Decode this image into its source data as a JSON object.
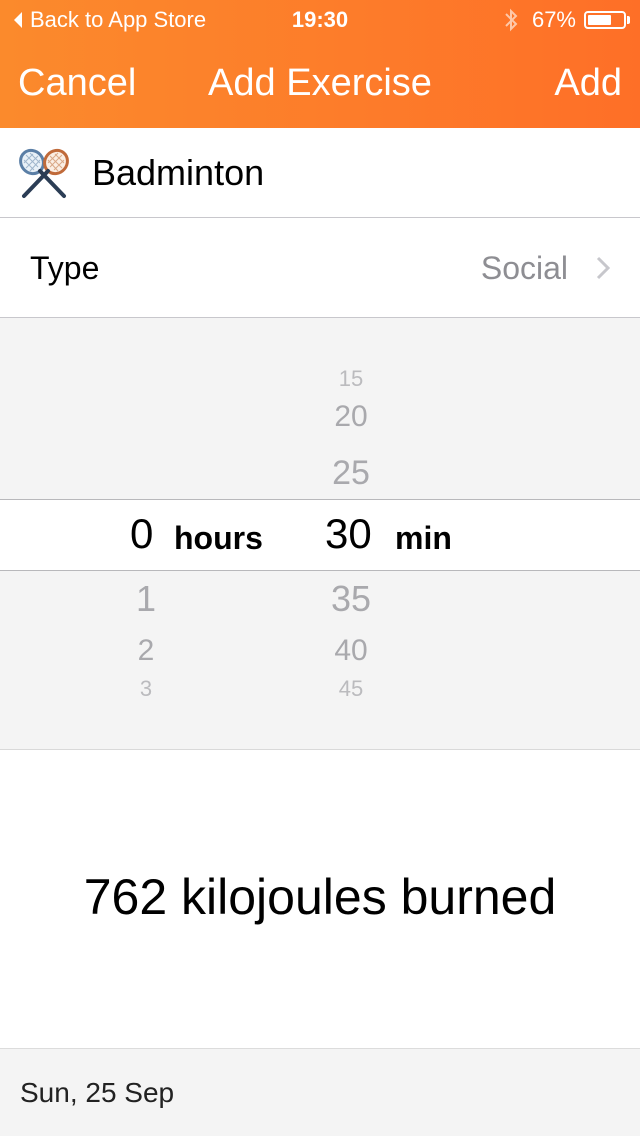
{
  "status_bar": {
    "back_label": "Back to App Store",
    "time": "19:30",
    "battery_text": "67%",
    "battery_level": 0.67,
    "bluetooth_icon": "bluetooth-icon"
  },
  "nav": {
    "cancel": "Cancel",
    "title": "Add Exercise",
    "add": "Add"
  },
  "exercise": {
    "icon": "badminton-rackets-icon",
    "name": "Badminton"
  },
  "type_row": {
    "label": "Type",
    "value": "Social"
  },
  "picker": {
    "hours": {
      "above": [],
      "selected": "0",
      "unit": "hours",
      "below": [
        "1",
        "2",
        "3"
      ]
    },
    "minutes": {
      "above": [
        "15",
        "20",
        "25"
      ],
      "selected": "30",
      "unit": "min",
      "below": [
        "35",
        "40",
        "45"
      ]
    }
  },
  "result": {
    "text": "762 kilojoules burned"
  },
  "footer": {
    "date": "Sun, 25 Sep"
  },
  "colors": {
    "header_start": "#fb8a2c",
    "header_end": "#fe6f27",
    "picker_bg": "#f4f4f4",
    "secondary_text": "#8e8e93"
  }
}
